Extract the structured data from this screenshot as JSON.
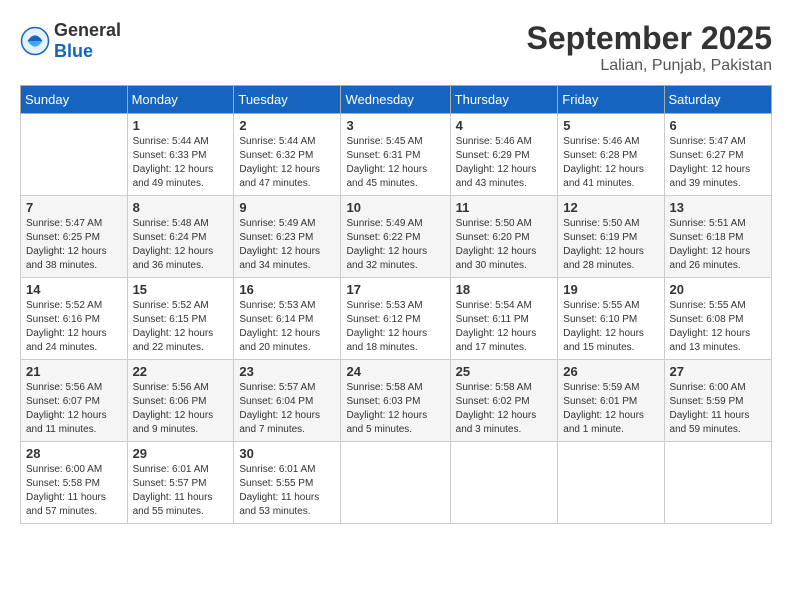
{
  "header": {
    "logo_general": "General",
    "logo_blue": "Blue",
    "month_title": "September 2025",
    "location": "Lalian, Punjab, Pakistan"
  },
  "weekdays": [
    "Sunday",
    "Monday",
    "Tuesday",
    "Wednesday",
    "Thursday",
    "Friday",
    "Saturday"
  ],
  "weeks": [
    [
      {
        "day": "",
        "info": ""
      },
      {
        "day": "1",
        "info": "Sunrise: 5:44 AM\nSunset: 6:33 PM\nDaylight: 12 hours\nand 49 minutes."
      },
      {
        "day": "2",
        "info": "Sunrise: 5:44 AM\nSunset: 6:32 PM\nDaylight: 12 hours\nand 47 minutes."
      },
      {
        "day": "3",
        "info": "Sunrise: 5:45 AM\nSunset: 6:31 PM\nDaylight: 12 hours\nand 45 minutes."
      },
      {
        "day": "4",
        "info": "Sunrise: 5:46 AM\nSunset: 6:29 PM\nDaylight: 12 hours\nand 43 minutes."
      },
      {
        "day": "5",
        "info": "Sunrise: 5:46 AM\nSunset: 6:28 PM\nDaylight: 12 hours\nand 41 minutes."
      },
      {
        "day": "6",
        "info": "Sunrise: 5:47 AM\nSunset: 6:27 PM\nDaylight: 12 hours\nand 39 minutes."
      }
    ],
    [
      {
        "day": "7",
        "info": "Sunrise: 5:47 AM\nSunset: 6:25 PM\nDaylight: 12 hours\nand 38 minutes."
      },
      {
        "day": "8",
        "info": "Sunrise: 5:48 AM\nSunset: 6:24 PM\nDaylight: 12 hours\nand 36 minutes."
      },
      {
        "day": "9",
        "info": "Sunrise: 5:49 AM\nSunset: 6:23 PM\nDaylight: 12 hours\nand 34 minutes."
      },
      {
        "day": "10",
        "info": "Sunrise: 5:49 AM\nSunset: 6:22 PM\nDaylight: 12 hours\nand 32 minutes."
      },
      {
        "day": "11",
        "info": "Sunrise: 5:50 AM\nSunset: 6:20 PM\nDaylight: 12 hours\nand 30 minutes."
      },
      {
        "day": "12",
        "info": "Sunrise: 5:50 AM\nSunset: 6:19 PM\nDaylight: 12 hours\nand 28 minutes."
      },
      {
        "day": "13",
        "info": "Sunrise: 5:51 AM\nSunset: 6:18 PM\nDaylight: 12 hours\nand 26 minutes."
      }
    ],
    [
      {
        "day": "14",
        "info": "Sunrise: 5:52 AM\nSunset: 6:16 PM\nDaylight: 12 hours\nand 24 minutes."
      },
      {
        "day": "15",
        "info": "Sunrise: 5:52 AM\nSunset: 6:15 PM\nDaylight: 12 hours\nand 22 minutes."
      },
      {
        "day": "16",
        "info": "Sunrise: 5:53 AM\nSunset: 6:14 PM\nDaylight: 12 hours\nand 20 minutes."
      },
      {
        "day": "17",
        "info": "Sunrise: 5:53 AM\nSunset: 6:12 PM\nDaylight: 12 hours\nand 18 minutes."
      },
      {
        "day": "18",
        "info": "Sunrise: 5:54 AM\nSunset: 6:11 PM\nDaylight: 12 hours\nand 17 minutes."
      },
      {
        "day": "19",
        "info": "Sunrise: 5:55 AM\nSunset: 6:10 PM\nDaylight: 12 hours\nand 15 minutes."
      },
      {
        "day": "20",
        "info": "Sunrise: 5:55 AM\nSunset: 6:08 PM\nDaylight: 12 hours\nand 13 minutes."
      }
    ],
    [
      {
        "day": "21",
        "info": "Sunrise: 5:56 AM\nSunset: 6:07 PM\nDaylight: 12 hours\nand 11 minutes."
      },
      {
        "day": "22",
        "info": "Sunrise: 5:56 AM\nSunset: 6:06 PM\nDaylight: 12 hours\nand 9 minutes."
      },
      {
        "day": "23",
        "info": "Sunrise: 5:57 AM\nSunset: 6:04 PM\nDaylight: 12 hours\nand 7 minutes."
      },
      {
        "day": "24",
        "info": "Sunrise: 5:58 AM\nSunset: 6:03 PM\nDaylight: 12 hours\nand 5 minutes."
      },
      {
        "day": "25",
        "info": "Sunrise: 5:58 AM\nSunset: 6:02 PM\nDaylight: 12 hours\nand 3 minutes."
      },
      {
        "day": "26",
        "info": "Sunrise: 5:59 AM\nSunset: 6:01 PM\nDaylight: 12 hours\nand 1 minute."
      },
      {
        "day": "27",
        "info": "Sunrise: 6:00 AM\nSunset: 5:59 PM\nDaylight: 11 hours\nand 59 minutes."
      }
    ],
    [
      {
        "day": "28",
        "info": "Sunrise: 6:00 AM\nSunset: 5:58 PM\nDaylight: 11 hours\nand 57 minutes."
      },
      {
        "day": "29",
        "info": "Sunrise: 6:01 AM\nSunset: 5:57 PM\nDaylight: 11 hours\nand 55 minutes."
      },
      {
        "day": "30",
        "info": "Sunrise: 6:01 AM\nSunset: 5:55 PM\nDaylight: 11 hours\nand 53 minutes."
      },
      {
        "day": "",
        "info": ""
      },
      {
        "day": "",
        "info": ""
      },
      {
        "day": "",
        "info": ""
      },
      {
        "day": "",
        "info": ""
      }
    ]
  ]
}
